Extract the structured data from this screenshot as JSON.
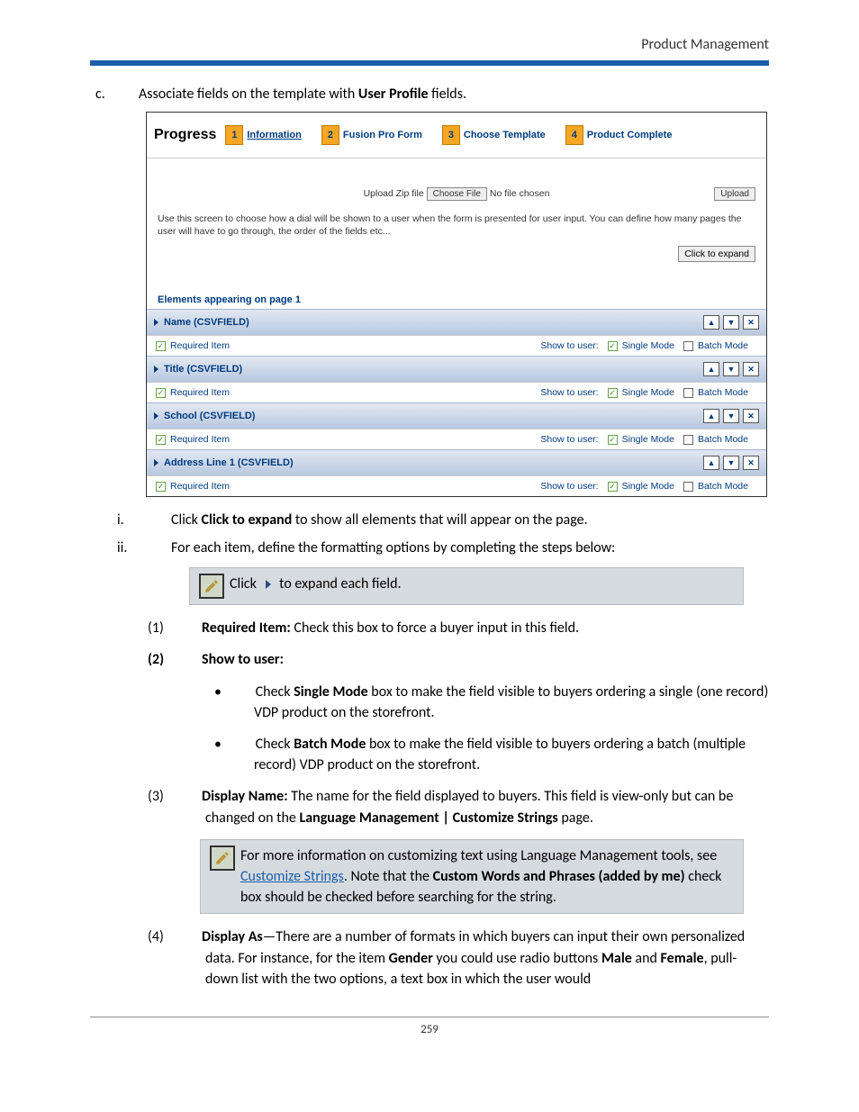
{
  "header": {
    "section": "Product Management"
  },
  "step_c": {
    "letter": "c.",
    "text_before": "Associate fields on the template with ",
    "bold": "User Profile",
    "text_after": " fields."
  },
  "screenshot": {
    "progress_label": "Progress",
    "steps": [
      {
        "num": "1",
        "label": "Information",
        "active": true
      },
      {
        "num": "2",
        "label": "Fusion Pro Form",
        "bold": true
      },
      {
        "num": "3",
        "label": "Choose Template",
        "bold": true
      },
      {
        "num": "4",
        "label": "Product Complete",
        "bold": true
      }
    ],
    "upload": {
      "zip_label": "Upload Zip file",
      "choose": "Choose File",
      "nofile": "No file chosen",
      "btn": "Upload"
    },
    "instruction": "Use this screen to choose how a dial will be shown to a user when the form is presented for user input. You can define how many pages the user will have to go through, the order of the fields etc...",
    "expand_btn": "Click to expand",
    "section_title": "Elements appearing on page 1",
    "labels": {
      "required": "Required Item",
      "show": "Show to user:",
      "single": "Single Mode",
      "batch": "Batch Mode"
    },
    "fields": [
      {
        "name": "Name (CSVFIELD)",
        "required": true,
        "single": true,
        "batch": false
      },
      {
        "name": "Title (CSVFIELD)",
        "required": true,
        "single": true,
        "batch": false
      },
      {
        "name": "School (CSVFIELD)",
        "required": true,
        "single": true,
        "batch": false
      },
      {
        "name": "Address Line 1 (CSVFIELD)",
        "required": true,
        "single": true,
        "batch": false
      }
    ]
  },
  "instructions": {
    "i": {
      "roman": "i.",
      "pre": "Click ",
      "bold": "Click to expand",
      "post": " to show all elements that will appear on the page."
    },
    "ii": {
      "roman": "ii.",
      "text": "For each item, define the formatting options by completing the steps below:"
    },
    "note1": {
      "pre": "Click ",
      "post": " to expand each field."
    },
    "n1": {
      "n": "(1)",
      "bold": "Required Item:",
      "text": " Check this box to force a buyer input in this field."
    },
    "n2": {
      "n": "(2)",
      "bold": "Show to user:"
    },
    "b1": {
      "pre": "Check ",
      "bold": "Single Mode",
      "post": " box to make the field visible to buyers ordering a single (one record) VDP product on the storefront."
    },
    "b2": {
      "pre": "Check ",
      "bold": "Batch Mode",
      "post": " box to make the field visible to buyers ordering a batch (multiple record) VDP product on the storefront."
    },
    "n3": {
      "n": "(3)",
      "bold": "Display Name:",
      "text1": " The name for the field displayed to buyers. This field is view-only but can be changed on the ",
      "bold2": "Language Management | Customize Strings",
      "text2": " page."
    },
    "note2": {
      "pre": "For more information on customizing text using Language Management tools, see ",
      "link": "Customize Strings",
      "mid": ". Note that the ",
      "bold": "Custom Words and Phrases (added by me)",
      "post": " check box should be checked before searching for the string."
    },
    "n4": {
      "n": "(4)",
      "bold": "Display As",
      "text1": "—There are a number of formats in which buyers can input their own personalized data. For instance, for the item ",
      "bold2": "Gender",
      "text2": " you could use radio buttons ",
      "bold3": "Male",
      "text3": " and ",
      "bold4": "Female",
      "text4": ", pull-down list with the two options, a text box in which the user would"
    }
  },
  "footer": {
    "page": "259"
  }
}
